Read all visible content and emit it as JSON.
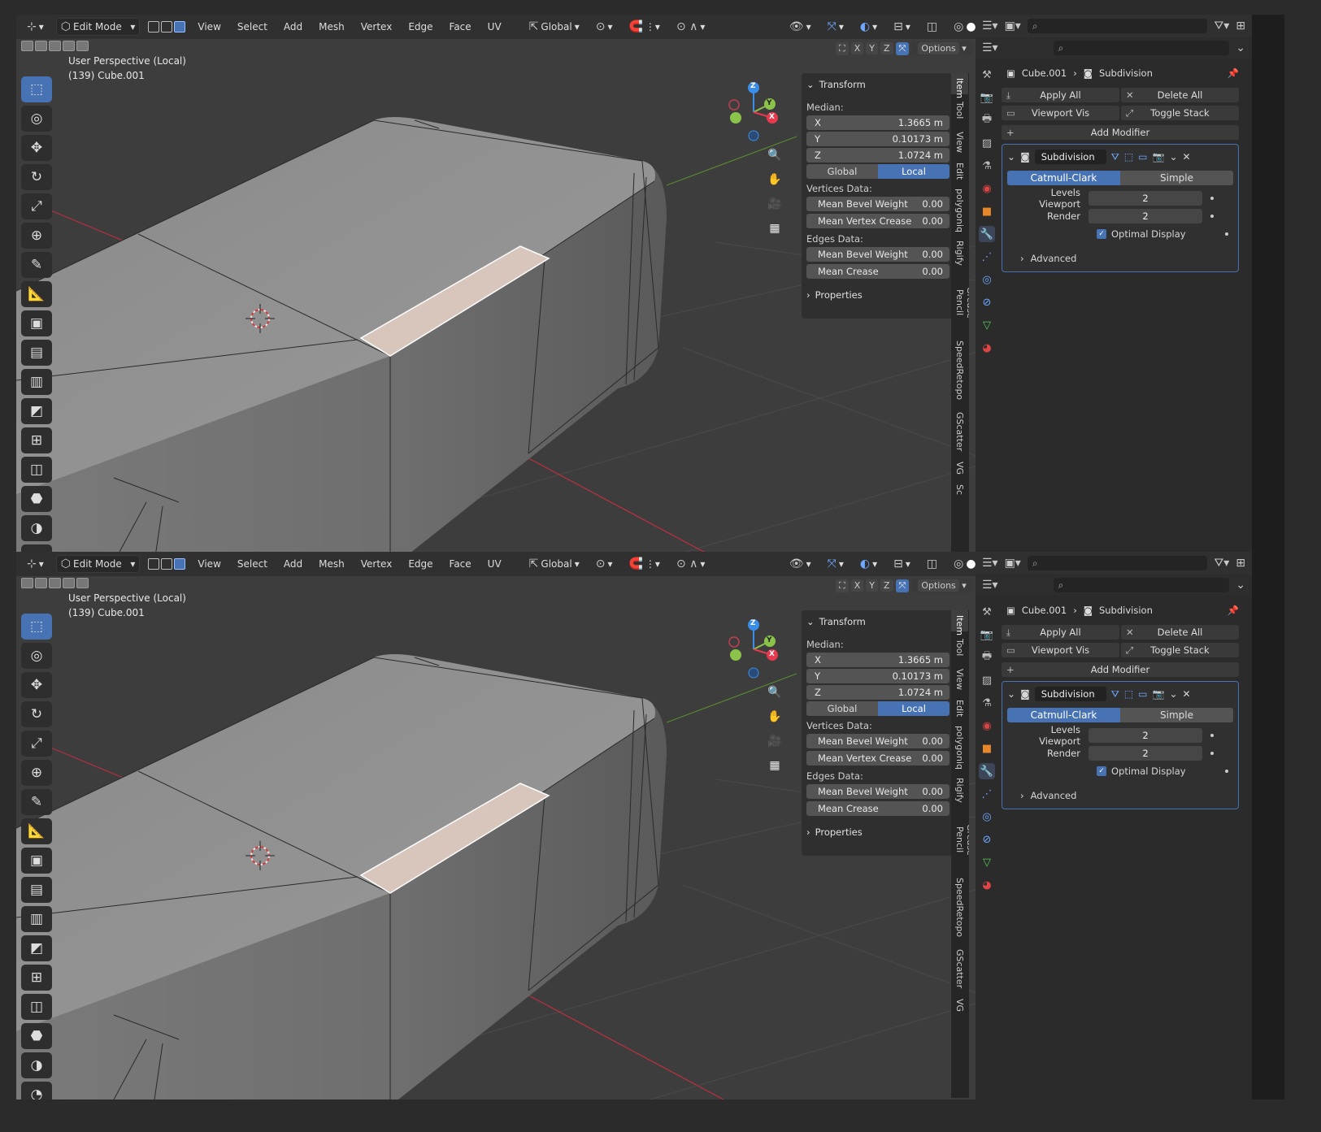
{
  "frames": [
    {
      "header": {
        "mode": "Edit Mode",
        "menus": [
          "View",
          "Select",
          "Add",
          "Mesh",
          "Vertex",
          "Edge",
          "Face",
          "UV"
        ],
        "orientation": "Global"
      },
      "axis_buttons": [
        "X",
        "Y",
        "Z"
      ],
      "options_label": "Options",
      "viewport": {
        "line1": "User Perspective (Local)",
        "line2": "(139) Cube.001"
      },
      "gizmo": {
        "z": "Z",
        "y": "Y",
        "x": "X"
      },
      "npanel": {
        "transform_title": "Transform",
        "median_label": "Median:",
        "x_label": "X",
        "x_value": "1.3665 m",
        "y_label": "Y",
        "y_value": "0.10173 m",
        "z_label": "Z",
        "z_value": "1.0724 m",
        "global_label": "Global",
        "local_label": "Local",
        "vertices_data": "Vertices Data:",
        "mean_bevel_weight_v": "Mean Bevel Weight",
        "mean_bevel_weight_v_val": "0.00",
        "mean_vertex_crease": "Mean Vertex Crease",
        "mean_vertex_crease_val": "0.00",
        "edges_data": "Edges Data:",
        "mean_bevel_weight_e": "Mean Bevel Weight",
        "mean_bevel_weight_e_val": "0.00",
        "mean_crease": "Mean Crease",
        "mean_crease_val": "0.00",
        "properties_title": "Properties"
      },
      "ntabs": [
        "Item",
        "Tool",
        "View",
        "Edit",
        "polygoniq",
        "Rigify",
        "Grease Pencil",
        "SpeedRetopo",
        "GScatter",
        "VG",
        "Sc"
      ],
      "properties": {
        "object": "Cube.001",
        "modifier_crumb": "Subdivision",
        "apply_all": "Apply All",
        "delete_all": "Delete All",
        "viewport_vis": "Viewport Vis",
        "toggle_stack": "Toggle Stack",
        "add_modifier": "Add Modifier",
        "modifier_name": "Subdivision",
        "catmull_clark": "Catmull-Clark",
        "simple": "Simple",
        "levels_viewport_label": "Levels Viewport",
        "levels_viewport": "2",
        "render_label": "Render",
        "render": "2",
        "optimal_display": "Optimal Display",
        "advanced": "Advanced"
      }
    },
    {
      "header": {
        "mode": "Edit Mode",
        "menus": [
          "View",
          "Select",
          "Add",
          "Mesh",
          "Vertex",
          "Edge",
          "Face",
          "UV"
        ],
        "orientation": "Global"
      },
      "axis_buttons": [
        "X",
        "Y",
        "Z"
      ],
      "options_label": "Options",
      "viewport": {
        "line1": "User Perspective (Local)",
        "line2": "(139) Cube.001"
      },
      "gizmo": {
        "z": "Z",
        "y": "Y",
        "x": "X"
      },
      "npanel": {
        "transform_title": "Transform",
        "median_label": "Median:",
        "x_label": "X",
        "x_value": "1.3665 m",
        "y_label": "Y",
        "y_value": "0.10173 m",
        "z_label": "Z",
        "z_value": "1.0724 m",
        "global_label": "Global",
        "local_label": "Local",
        "vertices_data": "Vertices Data:",
        "mean_bevel_weight_v": "Mean Bevel Weight",
        "mean_bevel_weight_v_val": "0.00",
        "mean_vertex_crease": "Mean Vertex Crease",
        "mean_vertex_crease_val": "0.00",
        "edges_data": "Edges Data:",
        "mean_bevel_weight_e": "Mean Bevel Weight",
        "mean_bevel_weight_e_val": "0.00",
        "mean_crease": "Mean Crease",
        "mean_crease_val": "0.00",
        "properties_title": "Properties"
      },
      "ntabs": [
        "Item",
        "Tool",
        "View",
        "Edit",
        "polygoniq",
        "Rigify",
        "Grease Pencil",
        "SpeedRetopo",
        "GScatter",
        "VG"
      ],
      "properties": {
        "object": "Cube.001",
        "modifier_crumb": "Subdivision",
        "apply_all": "Apply All",
        "delete_all": "Delete All",
        "viewport_vis": "Viewport Vis",
        "toggle_stack": "Toggle Stack",
        "add_modifier": "Add Modifier",
        "modifier_name": "Subdivision",
        "catmull_clark": "Catmull-Clark",
        "simple": "Simple",
        "levels_viewport_label": "Levels Viewport",
        "levels_viewport": "2",
        "render_label": "Render",
        "render": "2",
        "optimal_display": "Optimal Display",
        "advanced": "Advanced"
      }
    }
  ],
  "colors": {
    "accent": "#4772b3",
    "axis_x": "#e8394f",
    "axis_y": "#8bc34a",
    "axis_z": "#3b8ee8",
    "selection": "#e8d6cc"
  }
}
